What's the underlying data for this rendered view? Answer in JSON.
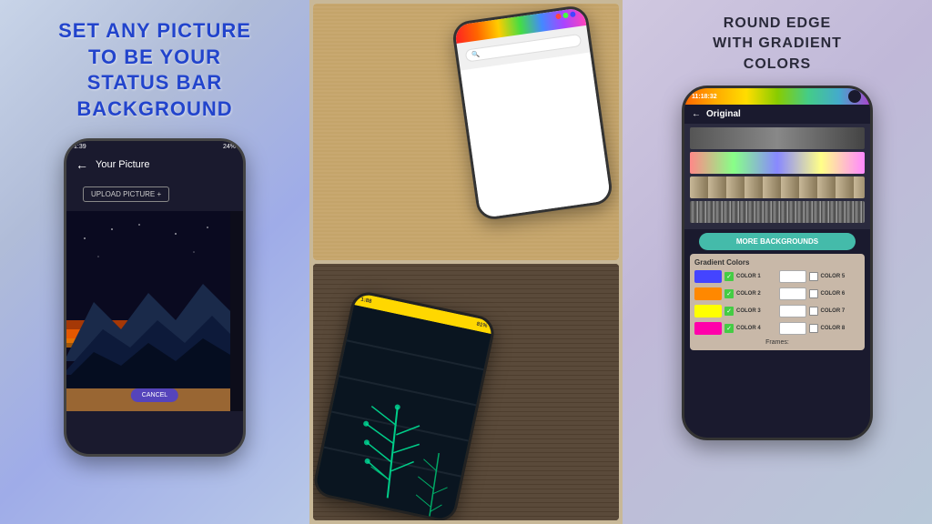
{
  "left": {
    "title_line1": "SET ANY PICTURE",
    "title_line2": "TO BE YOUR",
    "title_line3": "STATUS BAR BACKGROUND",
    "phone": {
      "time": "1:39",
      "battery": "24%",
      "header": "Your Picture",
      "upload_btn": "UPLOAD PICTURE +",
      "cancel_btn": "CANCEL"
    }
  },
  "middle": {
    "phone_top": {
      "has_colorful_top": true
    },
    "phone_bottom": {
      "time": "1:88",
      "battery": "81%"
    }
  },
  "right": {
    "title_line1": "ROUND EDGE",
    "title_line2": "WITH GRADIENT",
    "title_line3": "COLORS",
    "phone": {
      "time": "11:18:32",
      "header": "Original",
      "more_bg_label": "MORE BACKGROUNDS",
      "gradient_title": "Gradient Colors",
      "colors": [
        {
          "label": "COLOR 1",
          "color": "#4444ff",
          "checked": true
        },
        {
          "label": "COLOR 5",
          "color": "#ffffff",
          "checked": false
        },
        {
          "label": "COLOR 2",
          "color": "#ff8800",
          "checked": true
        },
        {
          "label": "COLOR 6",
          "color": "#ffffff",
          "checked": false
        },
        {
          "label": "COLOR 3",
          "color": "#ffff00",
          "checked": true
        },
        {
          "label": "COLOR 7",
          "color": "#ffffff",
          "checked": false
        },
        {
          "label": "COLOR 4",
          "color": "#ff00aa",
          "checked": true
        },
        {
          "label": "COLOR 8",
          "color": "#ffffff",
          "checked": false
        }
      ],
      "frames_label": "Frames:"
    }
  }
}
